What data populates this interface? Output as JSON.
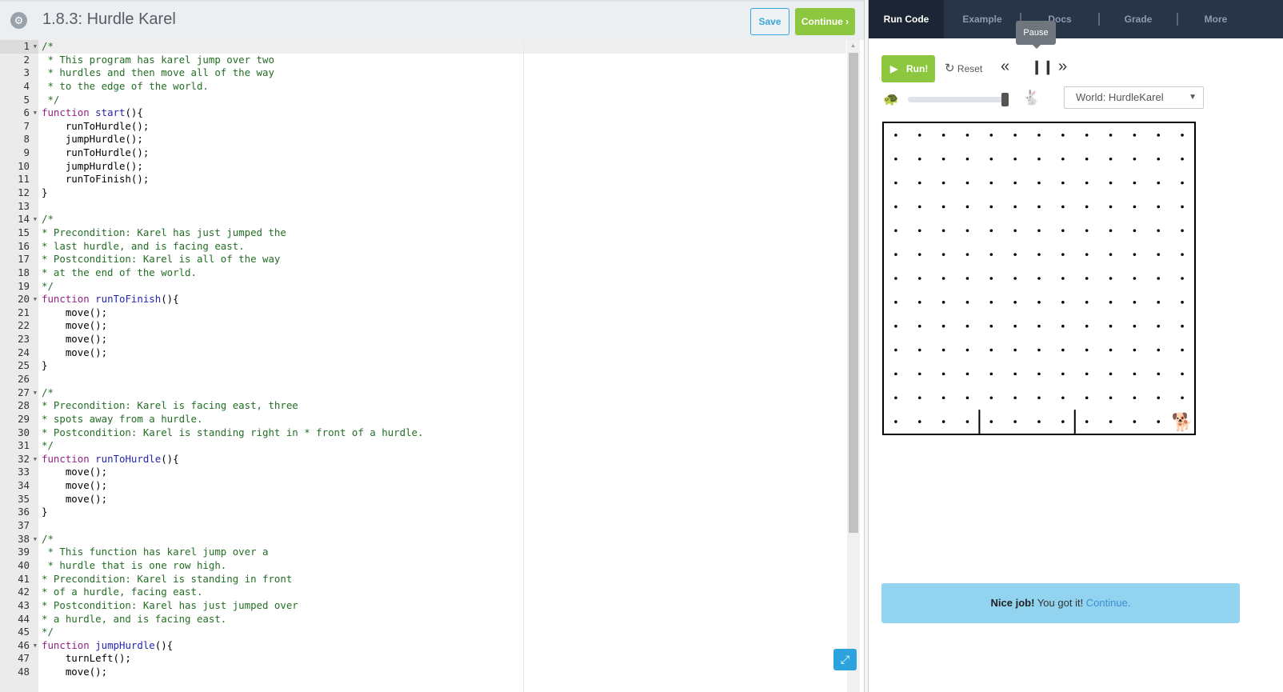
{
  "header": {
    "title": "1.8.3: Hurdle Karel",
    "save_label": "Save",
    "continue_label": "Continue ›"
  },
  "editor": {
    "active_line": 1,
    "lines": [
      {
        "t": "/*",
        "fold": true
      },
      {
        "t": " * This program has karel jump over two"
      },
      {
        "t": " * hurdles and then move all of the way"
      },
      {
        "t": " * to the edge of the world."
      },
      {
        "t": " */"
      },
      {
        "t": "function start(){",
        "fold": true
      },
      {
        "t": "    runToHurdle();"
      },
      {
        "t": "    jumpHurdle();"
      },
      {
        "t": "    runToHurdle();"
      },
      {
        "t": "    jumpHurdle();"
      },
      {
        "t": "    runToFinish();"
      },
      {
        "t": "}"
      },
      {
        "t": ""
      },
      {
        "t": "/*",
        "fold": true
      },
      {
        "t": "* Precondition: Karel has just jumped the"
      },
      {
        "t": "* last hurdle, and is facing east."
      },
      {
        "t": "* Postcondition: Karel is all of the way"
      },
      {
        "t": "* at the end of the world."
      },
      {
        "t": "*/"
      },
      {
        "t": "function runToFinish(){",
        "fold": true
      },
      {
        "t": "    move();"
      },
      {
        "t": "    move();"
      },
      {
        "t": "    move();"
      },
      {
        "t": "    move();"
      },
      {
        "t": "}"
      },
      {
        "t": ""
      },
      {
        "t": "/*",
        "fold": true
      },
      {
        "t": "* Precondition: Karel is facing east, three"
      },
      {
        "t": "* spots away from a hurdle."
      },
      {
        "t": "* Postcondition: Karel is standing right in * front of a hurdle."
      },
      {
        "t": "*/"
      },
      {
        "t": "function runToHurdle(){",
        "fold": true
      },
      {
        "t": "    move();"
      },
      {
        "t": "    move();"
      },
      {
        "t": "    move();"
      },
      {
        "t": "}"
      },
      {
        "t": ""
      },
      {
        "t": "/*",
        "fold": true
      },
      {
        "t": " * This function has karel jump over a"
      },
      {
        "t": " * hurdle that is one row high."
      },
      {
        "t": "* Precondition: Karel is standing in front"
      },
      {
        "t": "* of a hurdle, facing east."
      },
      {
        "t": "* Postcondition: Karel has just jumped over"
      },
      {
        "t": "* a hurdle, and is facing east."
      },
      {
        "t": "*/"
      },
      {
        "t": "function jumpHurdle(){",
        "fold": true
      },
      {
        "t": "    turnLeft();"
      },
      {
        "t": "    move();"
      }
    ]
  },
  "tabs": [
    {
      "label": "Run Code",
      "active": true
    },
    {
      "label": "Example"
    },
    {
      "label": "Docs"
    },
    {
      "label": "Grade"
    },
    {
      "label": "More"
    }
  ],
  "tooltip": "Pause",
  "controls": {
    "run_label": "Run!",
    "reset_label": "Reset",
    "speed": 0.97,
    "world_label": "World: HurdleKarel"
  },
  "world": {
    "cols": 13,
    "rows": 13,
    "walls": [
      {
        "after_col": 4,
        "row": 1
      },
      {
        "after_col": 8,
        "row": 1
      }
    ],
    "karel": {
      "col": 13,
      "row": 1,
      "facing": "east"
    }
  },
  "banner": {
    "bold": "Nice job!",
    "text": " You got it! ",
    "link": "Continue."
  },
  "colors": {
    "green": "#8dc63f",
    "blue": "#2aa3de",
    "nav": "#283548"
  }
}
